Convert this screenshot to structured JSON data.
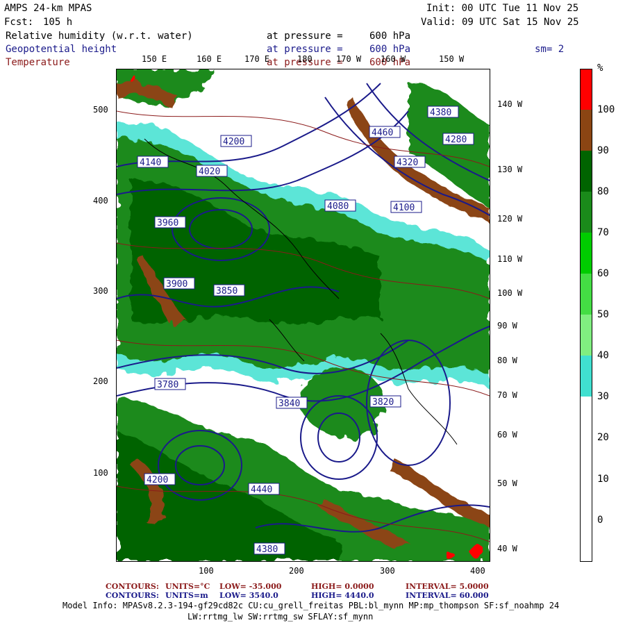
{
  "header": {
    "model": "AMPS 24-km MPAS",
    "fcst_label": "Fcst:",
    "fcst_value": "105 h",
    "init": "Init: 00 UTC Tue 11 Nov 25",
    "valid": "Valid: 09 UTC Sat 15 Nov 25",
    "fields": [
      {
        "name": "Relative humidity (w.r.t. water)",
        "pressure_label": "at pressure =",
        "pressure": "600 hPa"
      },
      {
        "name": "Geopotential height",
        "pressure_label": "at pressure =",
        "pressure": "600 hPa"
      },
      {
        "name": "Temperature",
        "pressure_label": "at pressure =",
        "pressure": "600 hPa"
      }
    ],
    "smoothing": "sm= 2"
  },
  "axes": {
    "x_ticks": [
      "100",
      "200",
      "300",
      "400"
    ],
    "y_ticks": [
      "500",
      "400",
      "300",
      "200",
      "100"
    ],
    "lon_top": [
      "150 E",
      "160 E",
      "170 E",
      "180",
      "170 W",
      "160 W",
      "150 W"
    ],
    "lon_right": [
      "140 W",
      "130 W",
      "120 W",
      "110 W",
      "100 W",
      "90 W",
      "80 W",
      "70 W",
      "60 W",
      "50 W",
      "40 W"
    ]
  },
  "colorbar": {
    "unit": "%",
    "labels": [
      "100",
      "90",
      "80",
      "70",
      "60",
      "50",
      "40",
      "30",
      "20",
      "10",
      "0"
    ],
    "colors": {
      "100": "#ff0000",
      "90": "#8b4513",
      "80": "#006400",
      "70": "#1a8a1a",
      "60": "#00cc00",
      "50": "#44dd44",
      "40": "#80ee80",
      "30": "#40e0d0",
      "below": "#ffffff"
    }
  },
  "contour_labels": {
    "height": [
      "4380",
      "4460",
      "4280",
      "4200",
      "4140",
      "4320",
      "4020",
      "3960",
      "4080",
      "3900",
      "4100",
      "3850",
      "3780",
      "3820",
      "3840",
      "4200",
      "4440",
      "4380"
    ],
    "height_color": "#1a1a8a",
    "temp_color": "#8b1a1a"
  },
  "footer": {
    "line1": {
      "label": "CONTOURS:",
      "units": "UNITS=°C",
      "low": "LOW= -35.000",
      "high": "HIGH= 0.0000",
      "interval": "INTERVAL= 5.0000"
    },
    "line2": {
      "label": "CONTOURS:",
      "units": "UNITS=m",
      "low": "LOW= 3540.0",
      "high": "HIGH= 4440.0",
      "interval": "INTERVAL= 60.000"
    },
    "model_info_1": "Model Info: MPASv8.2.3-194-gf29cd82c CU:cu_grell_freitas PBL:bl_mynn MP:mp_thompson SF:sf_noahmp 24",
    "model_info_2": "LW:rrtmg_lw SW:rrtmg_sw SFLAY:sf_mynn"
  }
}
